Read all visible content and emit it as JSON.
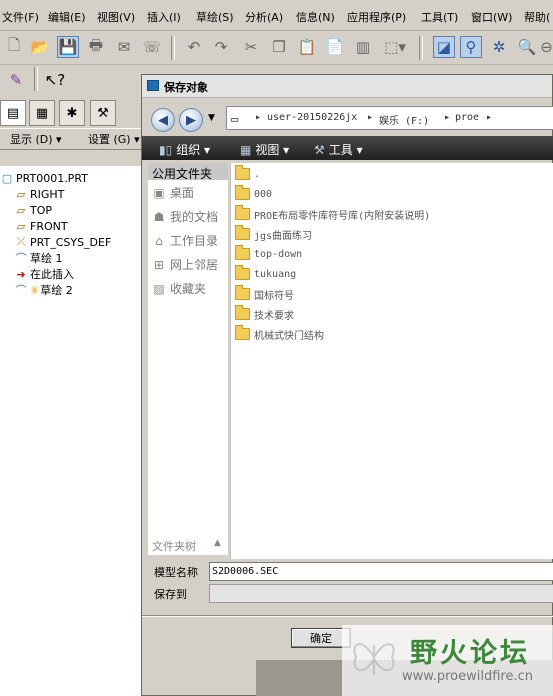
{
  "menubar": {
    "items": [
      "文件(F)",
      "编辑(E)",
      "视图(V)",
      "插入(I)",
      "草绘(S)",
      "分析(A)",
      "信息(N)",
      "应用程序(P)",
      "工具(T)",
      "窗口(W)",
      "帮助("
    ]
  },
  "toolbar": {
    "icons": [
      "new-icon",
      "open-icon",
      "save-icon",
      "print-icon",
      "send-icon",
      "mail-icon",
      "undo-icon",
      "redo-icon",
      "cut-icon",
      "copy-icon",
      "paste-icon",
      "paste-special-icon",
      "regenerate-icon",
      "select-box-icon",
      "datum-display-icon",
      "sketch-mode-icon",
      "view-orient-icon",
      "zoom-icon"
    ]
  },
  "left_panel": {
    "tabs": [
      "model-tree-tab",
      "layer-tab",
      "folder-tab",
      "favorites-tab"
    ],
    "display_label": "显示 (D) ▾",
    "settings_label": "设置 (G) ▾",
    "tree": [
      {
        "label": "PRT0001.PRT",
        "icon": "part-icon"
      },
      {
        "label": "RIGHT",
        "icon": "datum-plane-icon"
      },
      {
        "label": "TOP",
        "icon": "datum-plane-icon"
      },
      {
        "label": "FRONT",
        "icon": "datum-plane-icon"
      },
      {
        "label": "PRT_CSYS_DEF",
        "icon": "csys-icon"
      },
      {
        "label": "草绘 1",
        "icon": "sketch-icon"
      },
      {
        "label": "在此插入",
        "icon": "insert-here-icon"
      },
      {
        "label": "草绘 2",
        "icon": "sketch-active-icon"
      }
    ]
  },
  "dialog": {
    "title": "保存对象",
    "address": {
      "parts": [
        "user-20150226jx",
        "娱乐 (F:)",
        "proe"
      ]
    },
    "commands": {
      "organize": "组织",
      "views": "视图",
      "tools": "工具"
    },
    "nav": {
      "header": "公用文件夹",
      "items": [
        "桌面",
        "我的文档",
        "工作目录",
        "网上邻居",
        "收藏夹"
      ],
      "tree_label": "文件夹树"
    },
    "files": [
      ".",
      "000",
      "PROE布局零件库符号库(内附安装说明)",
      "jgs曲面练习",
      "top-down",
      "tukuang",
      "国标符号",
      "技术要求",
      "机械式快门结构"
    ],
    "model_name_label": "模型名称",
    "model_name_value": "S2D0006.SEC",
    "save_to_label": "保存到",
    "save_to_value": "",
    "ok_label": "确定"
  },
  "watermark": {
    "title": "野火论坛",
    "url": "www.proewildfire.cn"
  }
}
